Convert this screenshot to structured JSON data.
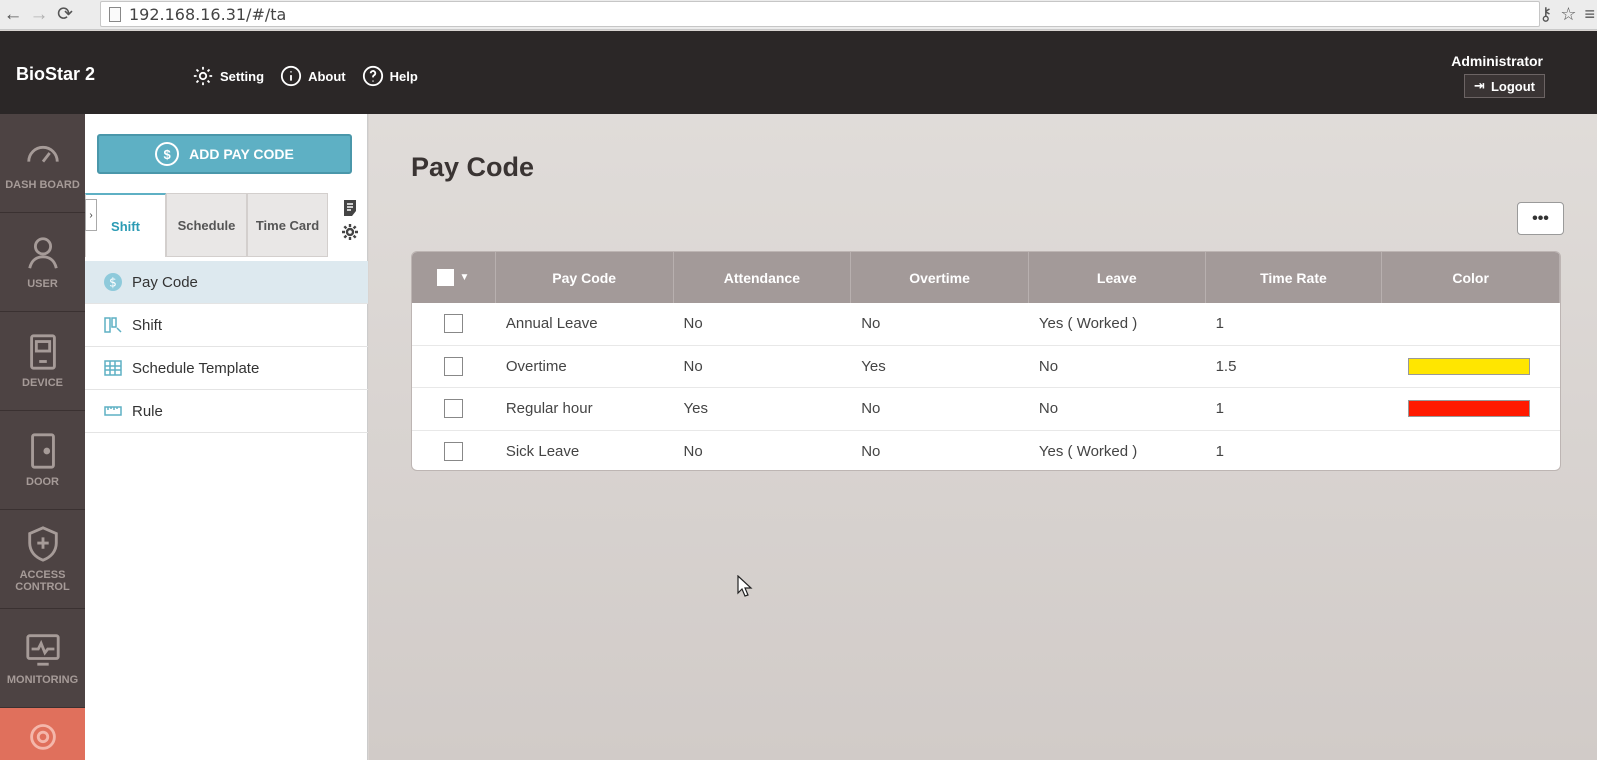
{
  "browser": {
    "url": "192.168.16.31/#/ta"
  },
  "header": {
    "brand": "BioStar 2",
    "nav": [
      {
        "label": "Setting",
        "icon": "gear-icon"
      },
      {
        "label": "About",
        "icon": "info-icon"
      },
      {
        "label": "Help",
        "icon": "help-icon"
      }
    ],
    "user_name": "Administrator",
    "logout_label": "Logout"
  },
  "left_nav": [
    {
      "label": "DASH BOARD",
      "icon": "dashboard-gauge-icon"
    },
    {
      "label": "USER",
      "icon": "user-icon"
    },
    {
      "label": "DEVICE",
      "icon": "device-icon"
    },
    {
      "label": "DOOR",
      "icon": "door-icon"
    },
    {
      "label": "ACCESS CONTROL",
      "icon": "access-control-shield-icon"
    },
    {
      "label": "MONITORING",
      "icon": "monitoring-icon"
    }
  ],
  "sidebar": {
    "add_button_label": "ADD PAY CODE",
    "tabs": [
      {
        "label": "Shift"
      },
      {
        "label": "Schedule"
      },
      {
        "label": "Time Card"
      }
    ],
    "menu": [
      {
        "label": "Pay Code",
        "icon": "pay-code-icon"
      },
      {
        "label": "Shift",
        "icon": "shift-icon"
      },
      {
        "label": "Schedule Template",
        "icon": "schedule-template-icon"
      },
      {
        "label": "Rule",
        "icon": "rule-icon"
      }
    ]
  },
  "main": {
    "title": "Pay Code",
    "more_label": "•••",
    "columns": [
      "Pay Code",
      "Attendance",
      "Overtime",
      "Leave",
      "Time Rate",
      "Color"
    ],
    "rows": [
      {
        "pay_code": "Annual Leave",
        "attendance": "No",
        "overtime": "No",
        "leave": "Yes ( Worked )",
        "time_rate": "1",
        "color": ""
      },
      {
        "pay_code": "Overtime",
        "attendance": "No",
        "overtime": "Yes",
        "leave": "No",
        "time_rate": "1.5",
        "color": "#ffe600"
      },
      {
        "pay_code": "Regular hour",
        "attendance": "Yes",
        "overtime": "No",
        "leave": "No",
        "time_rate": "1",
        "color": "#ff1a00"
      },
      {
        "pay_code": "Sick Leave",
        "attendance": "No",
        "overtime": "No",
        "leave": "Yes ( Worked )",
        "time_rate": "1",
        "color": ""
      }
    ]
  },
  "colors": {
    "header_bg": "#2b2727",
    "accent": "#5eb0c4",
    "left_nav_bg": "#4d4343",
    "grid_header_bg": "#a39a99"
  }
}
